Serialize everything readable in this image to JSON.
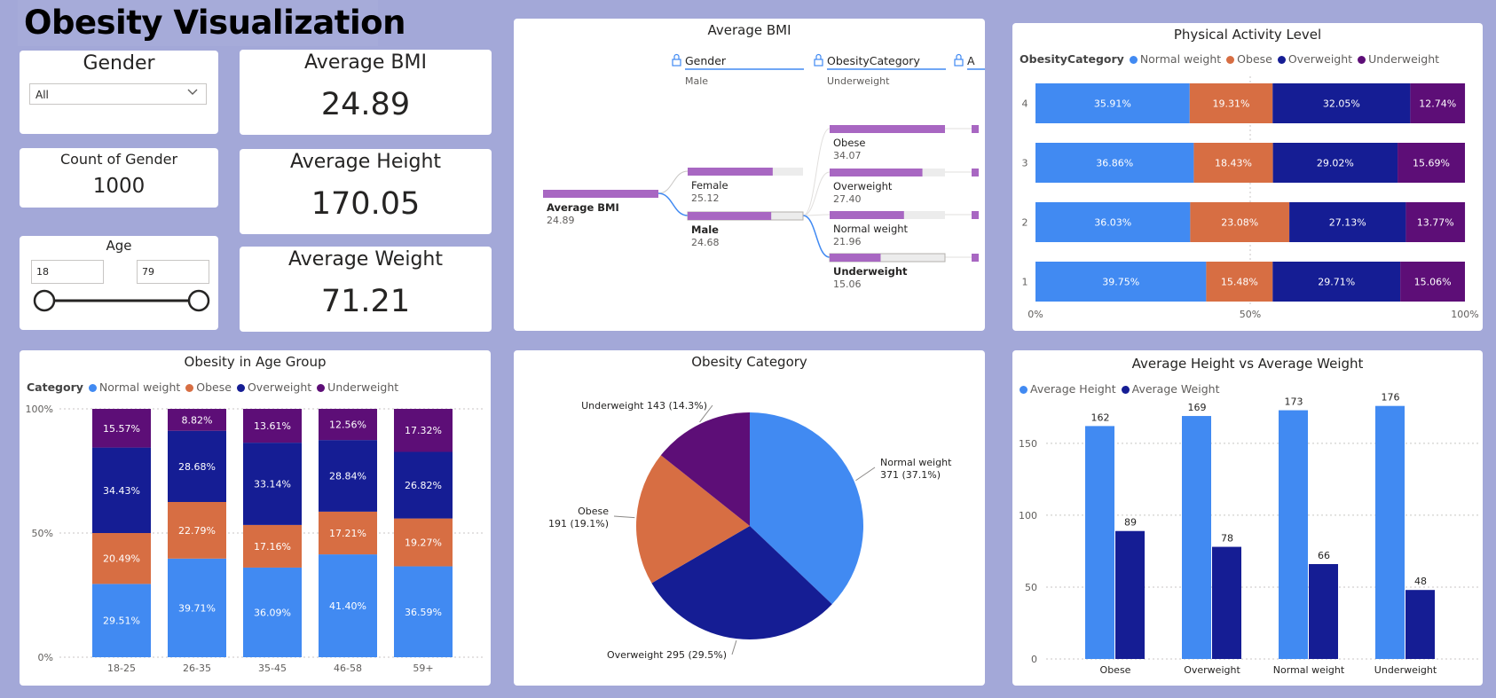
{
  "page": {
    "title": "Obesity Visualization",
    "background": "#a3a8d8"
  },
  "colors": {
    "normal": "#418af2",
    "obese": "#d76e43",
    "overweight": "#151d94",
    "underweight": "#5d0e77",
    "decomp": "#a867c2"
  },
  "slicers": {
    "gender": {
      "label": "Gender",
      "selected": "All",
      "icon": "chevron-down-icon"
    },
    "age": {
      "label": "Age",
      "min": "18",
      "max": "79",
      "range": [
        18,
        79
      ]
    }
  },
  "kpis": {
    "count_gender": {
      "label": "Count of Gender",
      "value": "1000"
    },
    "avg_bmi": {
      "label": "Average BMI",
      "value": "24.89"
    },
    "avg_height": {
      "label": "Average Height",
      "value": "170.05"
    },
    "avg_weight": {
      "label": "Average Weight",
      "value": "71.21"
    }
  },
  "decomp": {
    "title": "Average BMI",
    "levels": [
      {
        "header": "Gender",
        "selected": "Male",
        "icon": "lock-icon"
      },
      {
        "header": "ObesityCategory",
        "selected": "Underweight",
        "icon": "lock-icon"
      },
      {
        "header": "A",
        "icon": "lock-icon"
      }
    ]
  },
  "chart_data": [
    {
      "id": "physical_activity",
      "type": "bar",
      "orientation": "horizontal",
      "stacked": "100%",
      "title": "Physical Activity Level",
      "legend_title": "ObesityCategory",
      "legend_placement": "top-left",
      "categories": [
        "4",
        "3",
        "2",
        "1"
      ],
      "series": [
        {
          "name": "Normal weight",
          "values": [
            35.91,
            36.86,
            36.03,
            39.75
          ],
          "labels": [
            "35.91%",
            "36.86%",
            "36.03%",
            "39.75%"
          ]
        },
        {
          "name": "Obese",
          "values": [
            19.31,
            18.43,
            23.08,
            15.48
          ],
          "labels": [
            "19.31%",
            "18.43%",
            "23.08%",
            "15.48%"
          ]
        },
        {
          "name": "Overweight",
          "values": [
            32.05,
            29.02,
            27.13,
            29.71
          ],
          "labels": [
            "32.05%",
            "29.02%",
            "27.13%",
            "29.71%"
          ]
        },
        {
          "name": "Underweight",
          "values": [
            12.74,
            15.69,
            13.77,
            15.06
          ],
          "labels": [
            "12.74%",
            "15.69%",
            "13.77%",
            "15.06%"
          ]
        }
      ],
      "xticks": [
        "0%",
        "50%",
        "100%"
      ],
      "xlim": [
        0,
        100
      ]
    },
    {
      "id": "age_group",
      "type": "bar",
      "orientation": "vertical",
      "stacked": "100%",
      "title": "Obesity in Age Group",
      "legend_title": "Category",
      "legend_placement": "top-left",
      "categories": [
        "18-25",
        "26-35",
        "35-45",
        "46-58",
        "59+"
      ],
      "series": [
        {
          "name": "Normal weight",
          "values": [
            29.51,
            39.71,
            36.09,
            41.4,
            36.59
          ],
          "labels": [
            "29.51%",
            "39.71%",
            "36.09%",
            "41.40%",
            "36.59%"
          ]
        },
        {
          "name": "Obese",
          "values": [
            20.49,
            22.79,
            17.16,
            17.21,
            19.27
          ],
          "labels": [
            "20.49%",
            "22.79%",
            "17.16%",
            "17.21%",
            "19.27%"
          ]
        },
        {
          "name": "Overweight",
          "values": [
            34.43,
            28.68,
            33.14,
            28.84,
            26.82
          ],
          "labels": [
            "34.43%",
            "28.68%",
            "33.14%",
            "28.84%",
            "26.82%"
          ]
        },
        {
          "name": "Underweight",
          "values": [
            15.57,
            8.82,
            13.61,
            12.56,
            17.32
          ],
          "labels": [
            "15.57%",
            "8.82%",
            "13.61%",
            "12.56%",
            "17.32%"
          ]
        }
      ],
      "yticks": [
        "100%",
        "50%",
        "0%"
      ],
      "ylim": [
        0,
        100
      ]
    },
    {
      "id": "obesity_category",
      "type": "pie",
      "title": "Obesity Category",
      "slices": [
        {
          "name": "Normal weight",
          "value": 371,
          "label_line1": "Normal weight",
          "label_line2": "371 (37.1%)"
        },
        {
          "name": "Overweight",
          "value": 295,
          "label_line1": "Overweight 295 (29.5%)",
          "label_line2": ""
        },
        {
          "name": "Obese",
          "value": 191,
          "label_line1": "Obese",
          "label_line2": "191 (19.1%)"
        },
        {
          "name": "Underweight",
          "value": 143,
          "label_line1": "Underweight 143 (14.3%)",
          "label_line2": ""
        }
      ]
    },
    {
      "id": "height_weight",
      "type": "bar",
      "orientation": "vertical",
      "title": "Average Height vs Average Weight",
      "legend_placement": "top-left",
      "categories": [
        "Obese",
        "Overweight",
        "Normal weight",
        "Underweight"
      ],
      "series": [
        {
          "name": "Average Height",
          "values": [
            162,
            169,
            173,
            176
          ]
        },
        {
          "name": "Average Weight",
          "values": [
            89,
            78,
            66,
            48
          ]
        }
      ],
      "yticks": [
        "150",
        "100",
        "50",
        "0"
      ],
      "ylim": [
        0,
        190
      ]
    },
    {
      "id": "decomposition_tree",
      "type": "bar",
      "title": "Average BMI",
      "nodes": [
        {
          "level": 0,
          "name": "Average BMI",
          "value": 24.89,
          "value_label": "24.89",
          "bold": true
        },
        {
          "level": 1,
          "name": "Female",
          "value": 25.12,
          "value_label": "25.12",
          "bold": false
        },
        {
          "level": 1,
          "name": "Male",
          "value": 24.68,
          "value_label": "24.68",
          "bold": true
        },
        {
          "level": 2,
          "name": "Obese",
          "value": 34.07,
          "value_label": "34.07",
          "bold": false
        },
        {
          "level": 2,
          "name": "Overweight",
          "value": 27.4,
          "value_label": "27.40",
          "bold": false
        },
        {
          "level": 2,
          "name": "Normal weight",
          "value": 21.96,
          "value_label": "21.96",
          "bold": false
        },
        {
          "level": 2,
          "name": "Underweight",
          "value": 15.06,
          "value_label": "15.06",
          "bold": true
        }
      ]
    }
  ]
}
